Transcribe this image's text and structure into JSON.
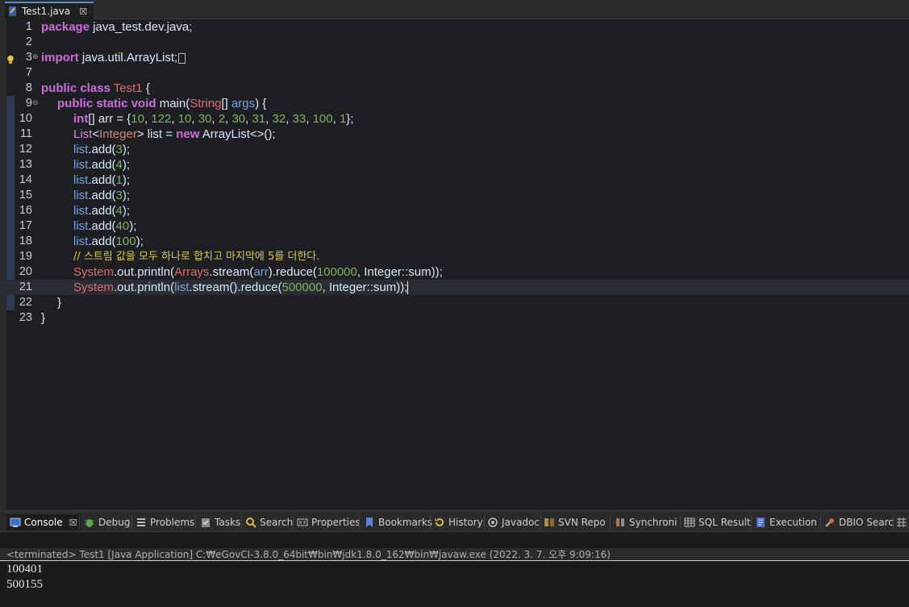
{
  "editor_tab": {
    "title": "Test1.java",
    "close": "☒"
  },
  "code": {
    "lines": [
      {
        "n": "1"
      },
      {
        "n": "2"
      },
      {
        "n": "3"
      },
      {
        "n": "7"
      },
      {
        "n": "8"
      },
      {
        "n": "9"
      },
      {
        "n": "10"
      },
      {
        "n": "11"
      },
      {
        "n": "12"
      },
      {
        "n": "13"
      },
      {
        "n": "14"
      },
      {
        "n": "15"
      },
      {
        "n": "16"
      },
      {
        "n": "17"
      },
      {
        "n": "18"
      },
      {
        "n": "19"
      },
      {
        "n": "20"
      },
      {
        "n": "21"
      },
      {
        "n": "22"
      },
      {
        "n": "23"
      }
    ],
    "t": {
      "package": "package",
      "pkgname": " java_test.dev.java;",
      "import": "import",
      "importname": " java.util.ArrayList;",
      "public": "public",
      "class": "class",
      "Test1": "Test1",
      "brace_open": " {",
      "public2": "public",
      "static": "static",
      "void": "void",
      "main": " main(",
      "String": "String",
      "brackets": "[] ",
      "args": "args",
      "main_end": ") {",
      "int": "int",
      "arr_decl": "[] arr = {",
      "nums": [
        "10",
        "122",
        "10",
        "30",
        "2",
        "30",
        "31",
        "32",
        "33",
        "100",
        "1"
      ],
      "arr_end": "};",
      "List": "List",
      "lt": "<",
      "Integer": "Integer",
      "gt": ">",
      "list_decl": " list = ",
      "new": "new",
      "arraylist": " ArrayList<>();",
      "list": "list",
      "add": ".add(",
      "close": ");",
      "adds": [
        "3",
        "4",
        "1",
        "3",
        "4",
        "40",
        "100"
      ],
      "comment": "// 스트림 값을 모두 하나로 합치고 마지막에 5를 더한다.",
      "System": "System",
      "out": ".out",
      "println": ".println(",
      "Arrays": "Arrays",
      "stream_arr": ".stream(",
      "arr": "arr",
      "reduce_open": ").reduce(",
      "n100000": "100000",
      "intsum": ", Integer::sum));",
      "list2": "list",
      "stream2": ".stream().reduce(",
      "n500000": "500000",
      "intsum2": ", Integer::sum));",
      "close_inner": "}",
      "close_outer": "}"
    }
  },
  "panel_tabs": [
    {
      "label": "Console",
      "icon": "console-icon",
      "close": "☒"
    },
    {
      "label": "Debug",
      "icon": "debug-icon"
    },
    {
      "label": "Problems",
      "icon": "problems-icon"
    },
    {
      "label": "Tasks",
      "icon": "tasks-icon"
    },
    {
      "label": "Search",
      "icon": "search-icon"
    },
    {
      "label": "Properties",
      "icon": "properties-icon"
    },
    {
      "label": "Bookmarks",
      "icon": "bookmark-icon"
    },
    {
      "label": "History",
      "icon": "history-icon"
    },
    {
      "label": "Javadoc",
      "icon": "javadoc-icon"
    },
    {
      "label": "SVN Repo",
      "icon": "svn-icon"
    },
    {
      "label": "Synchroni",
      "icon": "sync-icon"
    },
    {
      "label": "SQL Result",
      "icon": "table-icon"
    },
    {
      "label": "Execution",
      "icon": "execution-icon"
    },
    {
      "label": "DBIO Searc",
      "icon": "dbio-icon"
    }
  ],
  "console": {
    "terminated": "<terminated> Test1 [Java Application] C:₩eGovCI-3.8.0_64bit₩bin₩jdk1.8.0_162₩bin₩javaw.exe (2022. 3. 7. 오후 9:09:16)",
    "output": [
      "100401",
      "500155"
    ]
  }
}
